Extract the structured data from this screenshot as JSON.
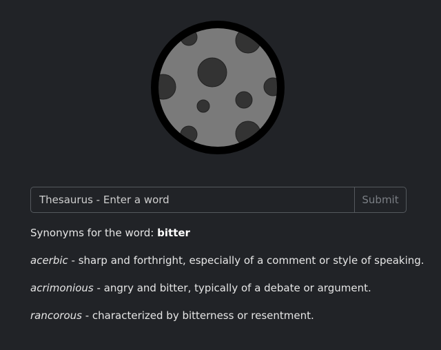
{
  "search": {
    "placeholder": "Thesaurus - Enter a word",
    "value": "",
    "submit_label": "Submit"
  },
  "results": {
    "heading_prefix": "Synonyms for the word:",
    "word": "bitter",
    "separator": " - ",
    "items": [
      {
        "word": "acerbic",
        "definition": "sharp and forthright, especially of a comment or style of speaking."
      },
      {
        "word": "acrimonious",
        "definition": "angry and bitter, typically of a debate or argument."
      },
      {
        "word": "rancorous",
        "definition": "characterized by bitterness or resentment."
      }
    ]
  },
  "colors": {
    "background": "#212327",
    "moon_fill": "#7a7a7a",
    "moon_border": "#000000",
    "crater": "#333333",
    "text": "#e6e6e6",
    "border": "#55595e",
    "submit_text": "#7b7f85"
  },
  "icons": {
    "logo": "moon-icon"
  }
}
